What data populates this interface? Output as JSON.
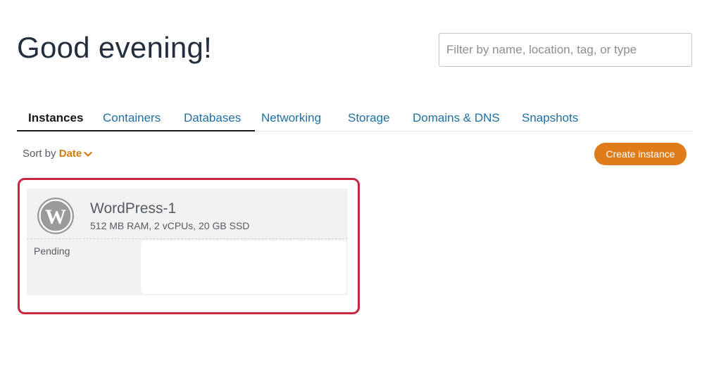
{
  "header": {
    "greeting": "Good evening!"
  },
  "search": {
    "placeholder": "Filter by name, location, tag, or type",
    "value": ""
  },
  "tabs": [
    {
      "label": "Instances",
      "active": true
    },
    {
      "label": "Containers",
      "active": false
    },
    {
      "label": "Databases",
      "active": false
    },
    {
      "label": "Networking",
      "active": false
    },
    {
      "label": "Storage",
      "active": false
    },
    {
      "label": "Domains & DNS",
      "active": false
    },
    {
      "label": "Snapshots",
      "active": false
    }
  ],
  "sort": {
    "label": "Sort by",
    "value": "Date",
    "icon": "chevron-down-icon"
  },
  "actions": {
    "create_label": "Create instance"
  },
  "instance": {
    "icon": "wordpress-icon",
    "name": "WordPress-1",
    "specs": "512 MB RAM, 2 vCPUs, 20 GB SSD",
    "status": "Pending"
  },
  "colors": {
    "accent": "#e07b19",
    "link": "#1f6fa3",
    "sort_value": "#d07c12",
    "highlight_border": "#c8253e",
    "card_bg": "#f2f2f2"
  }
}
